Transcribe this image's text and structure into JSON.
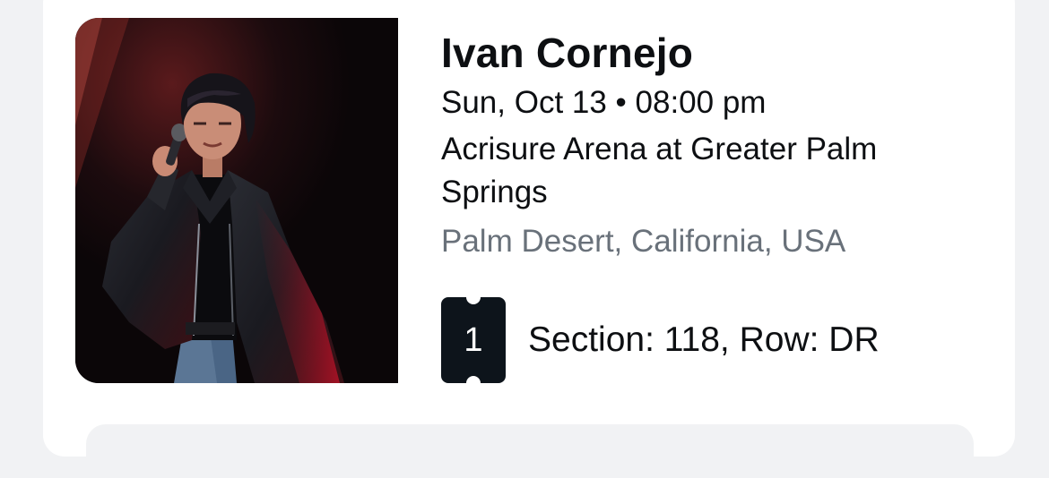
{
  "event": {
    "performer": "Ivan Cornejo",
    "datetime": "Sun, Oct 13 • 08:00 pm",
    "venue": "Acrisure Arena at Greater Palm Springs",
    "location": "Palm Desert, California, USA",
    "image": "concert-performer-photo"
  },
  "tickets": {
    "count": "1",
    "icon": "ticket-icon",
    "seat": "Section: 118, Row: DR"
  },
  "colors": {
    "primary_text": "#0d0f12",
    "secondary_text": "#69717a",
    "ticket_badge": "#0d141b",
    "card_background": "#ffffff",
    "page_background": "#f1f2f4"
  }
}
